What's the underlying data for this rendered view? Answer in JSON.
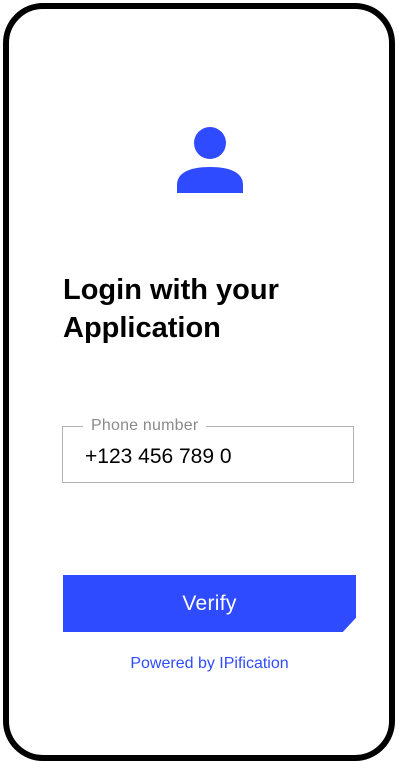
{
  "colors": {
    "accent": "#2f4bff",
    "frame": "#000000",
    "field_border": "#b3b3b3",
    "legend_text": "#8a8a8a"
  },
  "avatar": {
    "icon": "user-icon"
  },
  "login": {
    "title_line1": "Login with your",
    "title_line2": "Application"
  },
  "phone_field": {
    "label": "Phone number",
    "value": "+123 456 789 0"
  },
  "verify_button": {
    "label": "Verify"
  },
  "footer": {
    "powered_by": "Powered by IPification"
  }
}
